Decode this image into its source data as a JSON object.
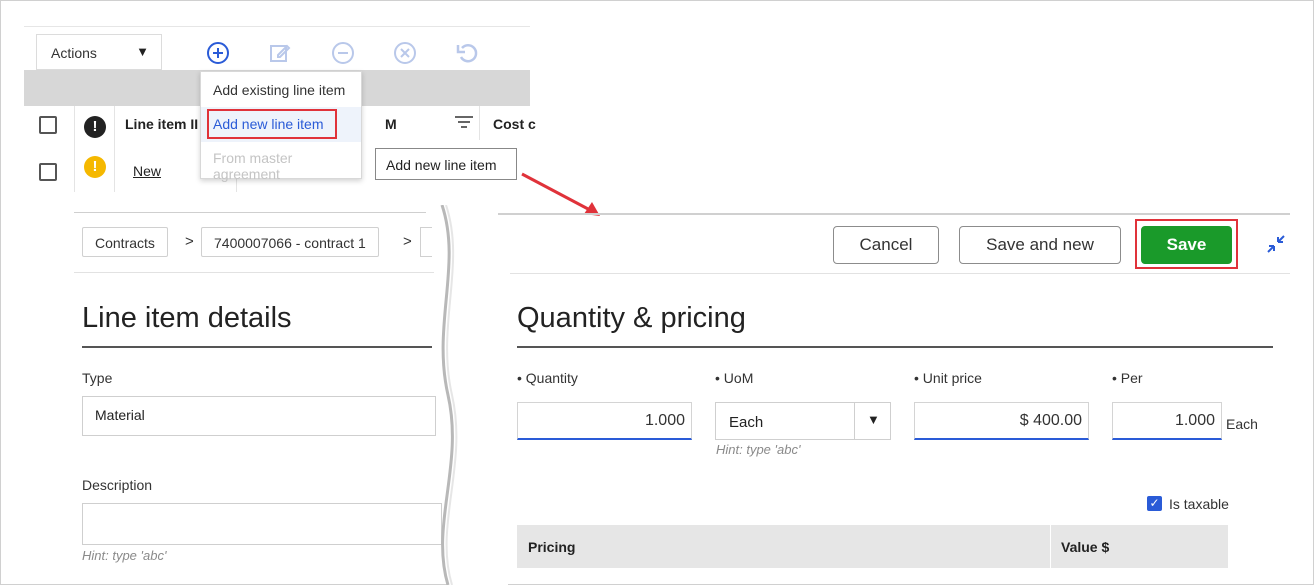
{
  "toolbar": {
    "actions_label": "Actions",
    "icons": [
      "add-icon",
      "edit-icon",
      "remove-icon",
      "cancel-icon",
      "undo-icon"
    ]
  },
  "dropdown": {
    "items": [
      {
        "label": "Add existing line item",
        "state": "normal"
      },
      {
        "label": "Add new line item",
        "state": "highlighted"
      },
      {
        "label": "From master agreement",
        "state": "disabled"
      }
    ]
  },
  "tooltip": "Add new line item",
  "grid": {
    "headers": [
      "Line item II",
      "M",
      "Cost c"
    ],
    "row": {
      "link": "New"
    }
  },
  "breadcrumb": {
    "items": [
      "Contracts",
      "7400007066 - contract 1"
    ],
    "separator": ">"
  },
  "line_item": {
    "title": "Line item details",
    "type_label": "Type",
    "type_value": "Material",
    "description_label": "Description",
    "description_value": "",
    "hint": "Hint: type 'abc'"
  },
  "header_buttons": {
    "cancel": "Cancel",
    "save_and_new": "Save and new",
    "save": "Save"
  },
  "pricing": {
    "title": "Quantity & pricing",
    "quantity_label": "Quantity",
    "quantity_value": "1.000",
    "uom_label": "UoM",
    "uom_value": "Each",
    "uom_hint": "Hint: type 'abc'",
    "unit_price_label": "Unit price",
    "unit_price_value": "$ 400.00",
    "per_label": "Per",
    "per_value": "1.000",
    "per_unit": "Each",
    "taxable_label": "Is taxable",
    "taxable_checked": true,
    "table_headers": [
      "Pricing",
      "Value $"
    ]
  },
  "colors": {
    "accent_blue": "#2a5bd7",
    "save_green": "#1a9a2a",
    "highlight_red": "#e0323a",
    "warning_yellow": "#f5b800"
  }
}
